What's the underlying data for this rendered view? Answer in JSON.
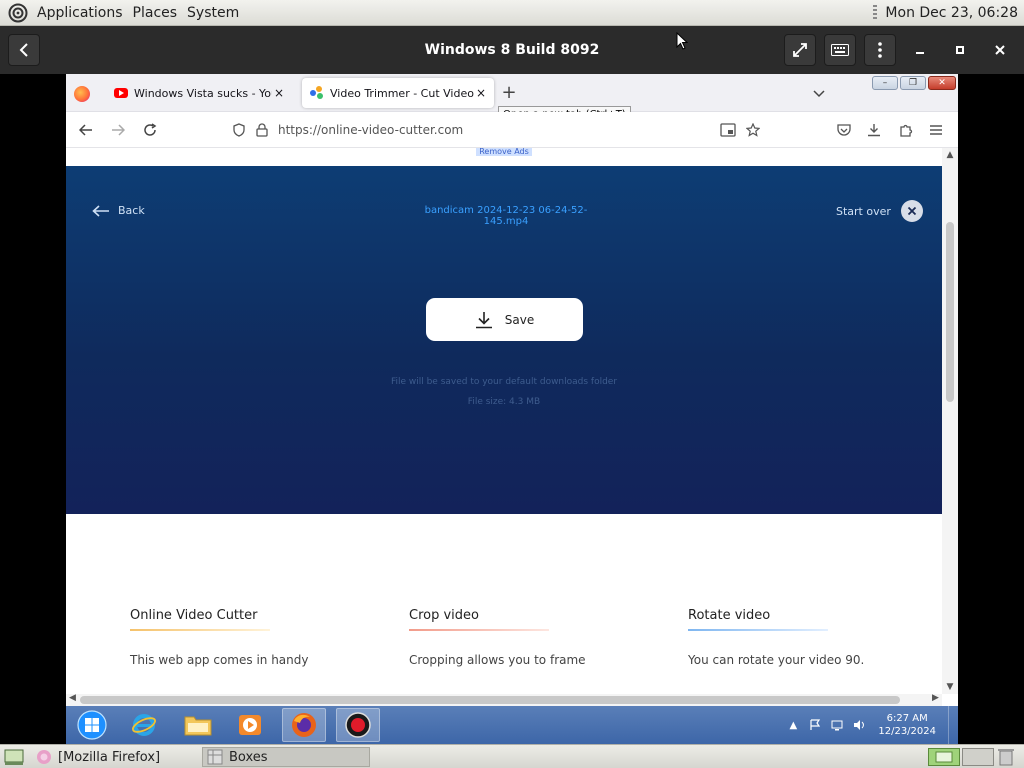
{
  "gnome_top": {
    "menus": [
      "Applications",
      "Places",
      "System"
    ],
    "clock": "Mon Dec 23, 06:28"
  },
  "boxes": {
    "title": "Windows 8 Build 8092"
  },
  "firefox": {
    "tabs": [
      {
        "label": "Windows Vista sucks - YouTube",
        "close": "×"
      },
      {
        "label": "Video Trimmer - Cut Video Onl",
        "close": "×"
      }
    ],
    "new_tab_symbol": "+",
    "tooltip": "Open a new tab (Ctrl+T)",
    "url": "https://online-video-cutter.com"
  },
  "page": {
    "peek_label": "Remove Ads",
    "back_label": "Back",
    "file_name": "bandicam 2024-12-23 06-24-52-145.mp4",
    "start_over_label": "Start over",
    "save_label": "Save",
    "save_note": "File will be saved to your default downloads folder",
    "file_size": "File size: 4.3 MB",
    "features": [
      {
        "title": "Online Video Cutter",
        "desc": "This web app comes in handy",
        "color": "#f5c26b"
      },
      {
        "title": "Crop video",
        "desc": "Cropping allows you to frame",
        "color": "#f29b8a"
      },
      {
        "title": "Rotate video",
        "desc": "You can rotate your video 90.",
        "color": "#7fb6f0"
      }
    ]
  },
  "win_taskbar": {
    "time": "6:27 AM",
    "date": "12/23/2024"
  },
  "gnome_bottom": {
    "tasks": [
      "[Mozilla Firefox]",
      "Boxes"
    ]
  },
  "colors": {
    "hero_top": "#0d3d74",
    "hero_bottom": "#13225a",
    "accent_blue": "#3aa0ff"
  }
}
